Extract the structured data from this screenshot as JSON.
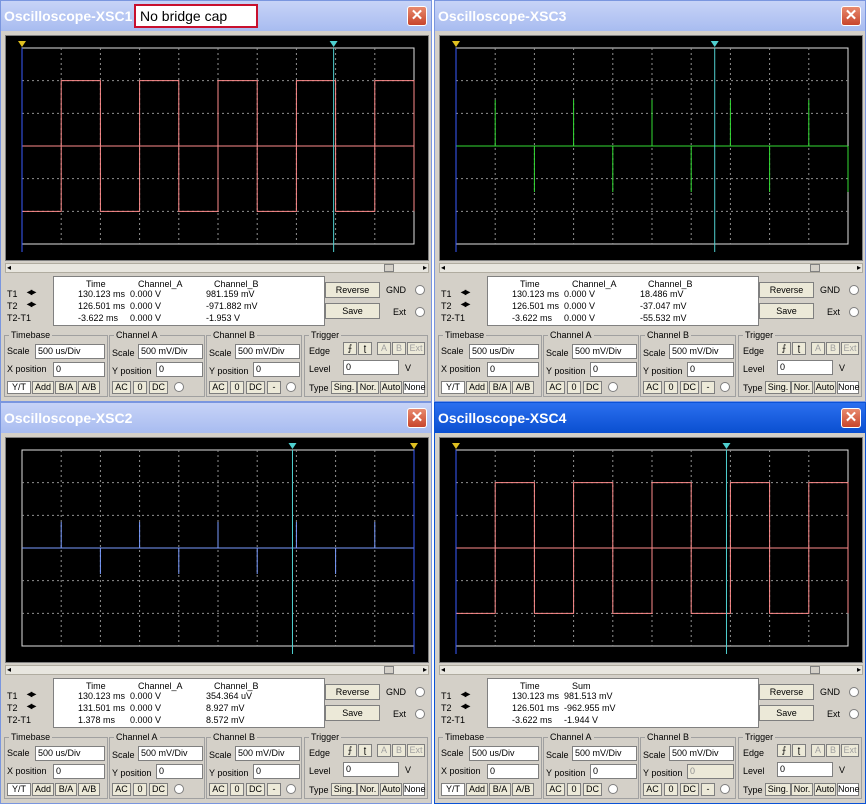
{
  "windows": [
    {
      "id": "xsc1",
      "title": "Oscilloscope-XSC1",
      "active": false,
      "note": "No bridge cap",
      "trace": {
        "kind": "square",
        "color": "#ff8c8c",
        "trailing_high": true
      },
      "t1_x": 0.0,
      "t2_x": 0.795,
      "readout": {
        "headers": [
          "Time",
          "Channel_A",
          "Channel_B"
        ],
        "rows": [
          {
            "label": "T1",
            "values": [
              "130.123 ms",
              "0.000 V",
              "981.159 mV"
            ]
          },
          {
            "label": "T2",
            "values": [
              "126.501 ms",
              "0.000 V",
              "-971.882 mV"
            ]
          },
          {
            "label": "T2-T1",
            "values": [
              "-3.622 ms",
              "0.000 V",
              "-1.953 V"
            ]
          }
        ]
      },
      "timebase": {
        "scale": "500 us/Div",
        "xpos": "0"
      },
      "channel_a": {
        "scale": "500 mV/Div",
        "ypos": "0"
      },
      "channel_b": {
        "scale": "500 mV/Div",
        "ypos": "0",
        "ypos_disabled": false
      },
      "trigger": {
        "level": "0",
        "unit": "V"
      }
    },
    {
      "id": "xsc3",
      "title": "Oscilloscope-XSC3",
      "active": false,
      "note": "",
      "trace": {
        "kind": "spikes",
        "color": "#33dd33"
      },
      "t1_x": 0.0,
      "t2_x": 0.66,
      "readout": {
        "headers": [
          "Time",
          "Channel_A",
          "Channel_B"
        ],
        "rows": [
          {
            "label": "T1",
            "values": [
              "130.123 ms",
              "0.000 V",
              "18.486 mV"
            ]
          },
          {
            "label": "T2",
            "values": [
              "126.501 ms",
              "0.000 V",
              "-37.047 mV"
            ]
          },
          {
            "label": "T2-T1",
            "values": [
              "-3.622 ms",
              "0.000 V",
              "-55.532 mV"
            ]
          }
        ]
      },
      "timebase": {
        "scale": "500 us/Div",
        "xpos": "0"
      },
      "channel_a": {
        "scale": "500 mV/Div",
        "ypos": "0"
      },
      "channel_b": {
        "scale": "500 mV/Div",
        "ypos": "0",
        "ypos_disabled": false
      },
      "trigger": {
        "level": "0",
        "unit": "V"
      }
    },
    {
      "id": "xsc2",
      "title": "Oscilloscope-XSC2",
      "active": false,
      "note": "",
      "trace": {
        "kind": "spikes_small",
        "color": "#7a9cff"
      },
      "t1_x": 1.0,
      "t2_x": 0.69,
      "readout": {
        "headers": [
          "Time",
          "Channel_A",
          "Channel_B"
        ],
        "rows": [
          {
            "label": "T1",
            "values": [
              "130.123 ms",
              "0.000 V",
              "354.364 uV"
            ]
          },
          {
            "label": "T2",
            "values": [
              "131.501 ms",
              "0.000 V",
              "8.927 mV"
            ]
          },
          {
            "label": "T2-T1",
            "values": [
              "1.378 ms",
              "0.000 V",
              "8.572 mV"
            ]
          }
        ]
      },
      "timebase": {
        "scale": "500 us/Div",
        "xpos": "0"
      },
      "channel_a": {
        "scale": "500 mV/Div",
        "ypos": "0"
      },
      "channel_b": {
        "scale": "500 mV/Div",
        "ypos": "0",
        "ypos_disabled": false
      },
      "trigger": {
        "level": "0",
        "unit": "V"
      }
    },
    {
      "id": "xsc4",
      "title": "Oscilloscope-XSC4",
      "active": true,
      "note": "",
      "trace": {
        "kind": "square",
        "color": "#ff8c8c",
        "trailing_high": true
      },
      "t1_x": 0.0,
      "t2_x": 0.69,
      "readout": {
        "headers": [
          "Time",
          "Sum",
          ""
        ],
        "rows": [
          {
            "label": "T1",
            "values": [
              "130.123 ms",
              "981.513 mV",
              ""
            ]
          },
          {
            "label": "T2",
            "values": [
              "126.501 ms",
              "-962.955 mV",
              ""
            ]
          },
          {
            "label": "T2-T1",
            "values": [
              "-3.622 ms",
              "-1.944 V",
              ""
            ]
          }
        ]
      },
      "timebase": {
        "scale": "500 us/Div",
        "xpos": "0"
      },
      "channel_a": {
        "scale": "500 mV/Div",
        "ypos": "0"
      },
      "channel_b": {
        "scale": "500 mV/Div",
        "ypos": "0",
        "ypos_disabled": true
      },
      "trigger": {
        "level": "0",
        "unit": "V"
      }
    }
  ],
  "labels": {
    "reverse": "Reverse",
    "save": "Save",
    "gnd": "GND",
    "ext": "Ext",
    "timebase": "Timebase",
    "channel_a": "Channel A",
    "channel_b": "Channel B",
    "trigger": "Trigger",
    "scale": "Scale",
    "xpos": "X position",
    "ypos": "Y position",
    "edge": "Edge",
    "level": "Level",
    "type": "Type",
    "yt": "Y/T",
    "add": "Add",
    "ba": "B/A",
    "ab": "A/B",
    "ac": "AC",
    "zero": "0",
    "dc": "DC",
    "minus": "-",
    "sing": "Sing.",
    "nor": "Nor.",
    "auto": "Auto",
    "none": "None",
    "trig_a": "A",
    "trig_b": "B",
    "trig_ext": "Ext",
    "close": "✕",
    "arrows": "◂▸"
  },
  "colors": {
    "cursor_t1": "#3a5cff",
    "cursor_t2": "#4fd0d0",
    "grid": "#e0e0e0"
  }
}
